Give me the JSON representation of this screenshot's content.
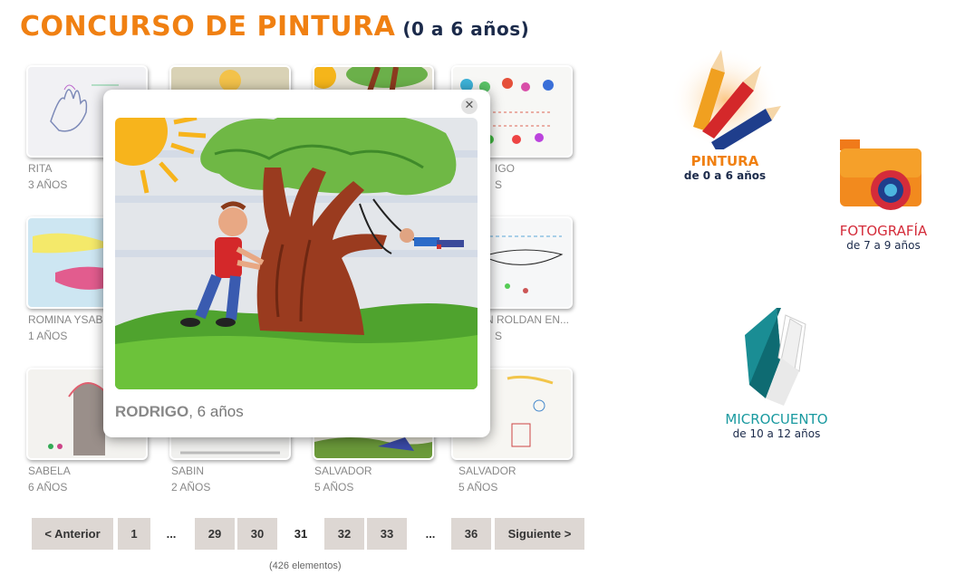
{
  "header": {
    "title": "CONCURSO DE PINTURA",
    "subtitle": "(0 a 6 años)"
  },
  "gallery": [
    {
      "name": "RITA",
      "age": "3 AÑOS"
    },
    {
      "name": "",
      "age": ""
    },
    {
      "name": "",
      "age": ""
    },
    {
      "name": "IGO",
      "age": "S"
    },
    {
      "name": "ROMINA YSAB",
      "age": "1 AÑOS"
    },
    {
      "name": "",
      "age": ""
    },
    {
      "name": "",
      "age": ""
    },
    {
      "name": "N ROLDAN EN...",
      "age": "S"
    },
    {
      "name": "SABELA",
      "age": "6 AÑOS"
    },
    {
      "name": "SABIN",
      "age": "2 AÑOS"
    },
    {
      "name": "SALVADOR",
      "age": "5 AÑOS"
    },
    {
      "name": "SALVADOR",
      "age": "5 AÑOS"
    }
  ],
  "modal": {
    "name": "RODRIGO",
    "age": ", 6 años",
    "close_glyph": "✕"
  },
  "pagination": {
    "prev": "< Anterior",
    "p1": "1",
    "ellipsis1": "...",
    "p29": "29",
    "p30": "30",
    "p31": "31",
    "p32": "32",
    "p33": "33",
    "ellipsis2": "...",
    "p36": "36",
    "next": "Siguiente >"
  },
  "count": "(426 elementos)",
  "categories": {
    "pintura": {
      "title": "PINTURA",
      "sub": "de 0 a 6 años",
      "color": "#f08012",
      "icon": "pencils-icon"
    },
    "fotografia": {
      "title": "FOTOGRAFÍA",
      "sub": "de 7 a 9 años",
      "color": "#d42c3a",
      "icon": "camera-icon"
    },
    "microcuento": {
      "title": "MICROCUENTO",
      "sub": "de 10 a 12 años",
      "color": "#1a9aa0",
      "icon": "book-icon"
    }
  }
}
